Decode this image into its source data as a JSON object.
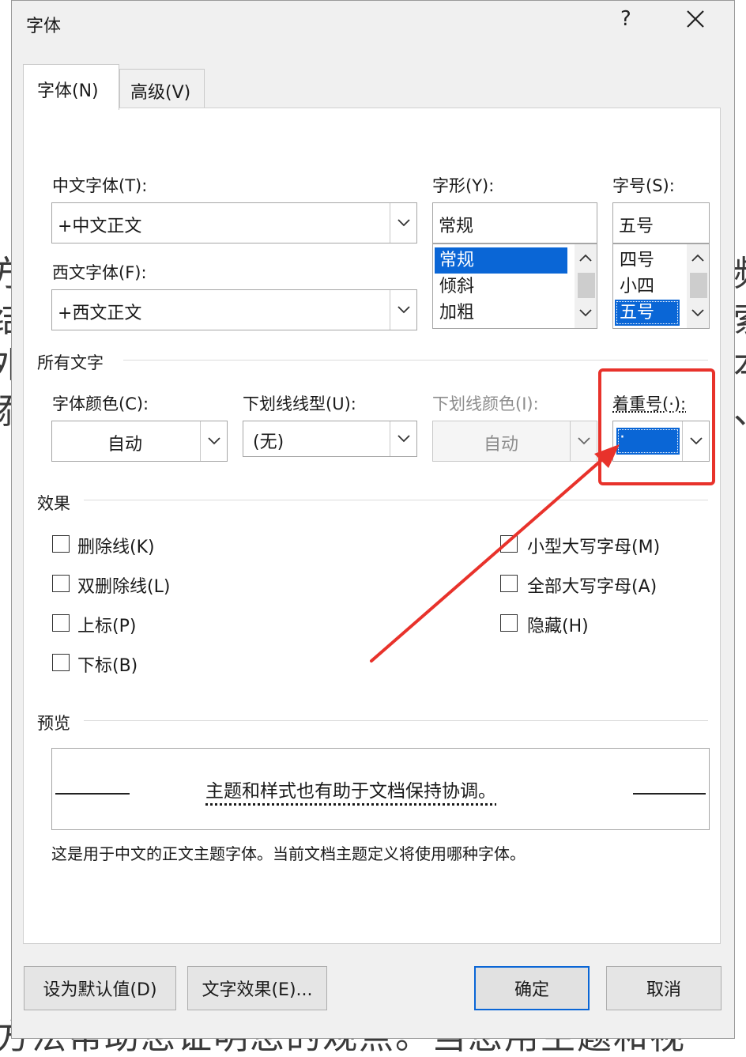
{
  "window": {
    "title": "字体",
    "help_label": "?",
    "close_label": "✕"
  },
  "tabs": [
    {
      "label": "字体(N)"
    },
    {
      "label": "高级(V)"
    }
  ],
  "chinese_font": {
    "label": "中文字体(T):",
    "value": "+中文正文"
  },
  "western_font": {
    "label": "西文字体(F):",
    "value": "+西文正文"
  },
  "font_style": {
    "label": "字形(Y):",
    "value": "常规",
    "options": [
      "常规",
      "倾斜",
      "加粗"
    ],
    "selected_index": 0
  },
  "font_size": {
    "label": "字号(S):",
    "value": "五号",
    "options": [
      "四号",
      "小四",
      "五号"
    ],
    "selected_index": 2
  },
  "all_text": {
    "section_label": "所有文字",
    "font_color": {
      "label": "字体颜色(C):",
      "value": "自动"
    },
    "underline_style": {
      "label": "下划线线型(U):",
      "value": "(无)"
    },
    "underline_color": {
      "label": "下划线颜色(I):",
      "value": "自动"
    },
    "emphasis_mark": {
      "label": "着重号(·):",
      "value": "·"
    }
  },
  "effects": {
    "section_label": "效果",
    "strikethrough": {
      "label": "删除线(K)",
      "checked": false
    },
    "double_strikethrough": {
      "label": "双删除线(L)",
      "checked": false
    },
    "superscript": {
      "label": "上标(P)",
      "checked": false
    },
    "subscript": {
      "label": "下标(B)",
      "checked": false
    },
    "small_caps": {
      "label": "小型大写字母(M)",
      "checked": false
    },
    "all_caps": {
      "label": "全部大写字母(A)",
      "checked": false
    },
    "hidden": {
      "label": "隐藏(H)",
      "checked": false
    }
  },
  "preview": {
    "section_label": "预览",
    "sample_text": "主题和样式也有助于文档保持协调。",
    "description": "这是用于中文的正文主题字体。当前文档主题定义将使用哪种字体。"
  },
  "buttons": {
    "set_default": "设为默认值(D)",
    "text_effects": "文字效果(E)...",
    "ok": "确定",
    "cancel": "取消"
  },
  "background_text": {
    "bottom_line": "方法帮助您证明您的观点。当您用主题和视"
  },
  "colors": {
    "accent": "#0a66d6",
    "annotation_red": "#e8322b",
    "dialog_bg": "#f0f0f0"
  }
}
